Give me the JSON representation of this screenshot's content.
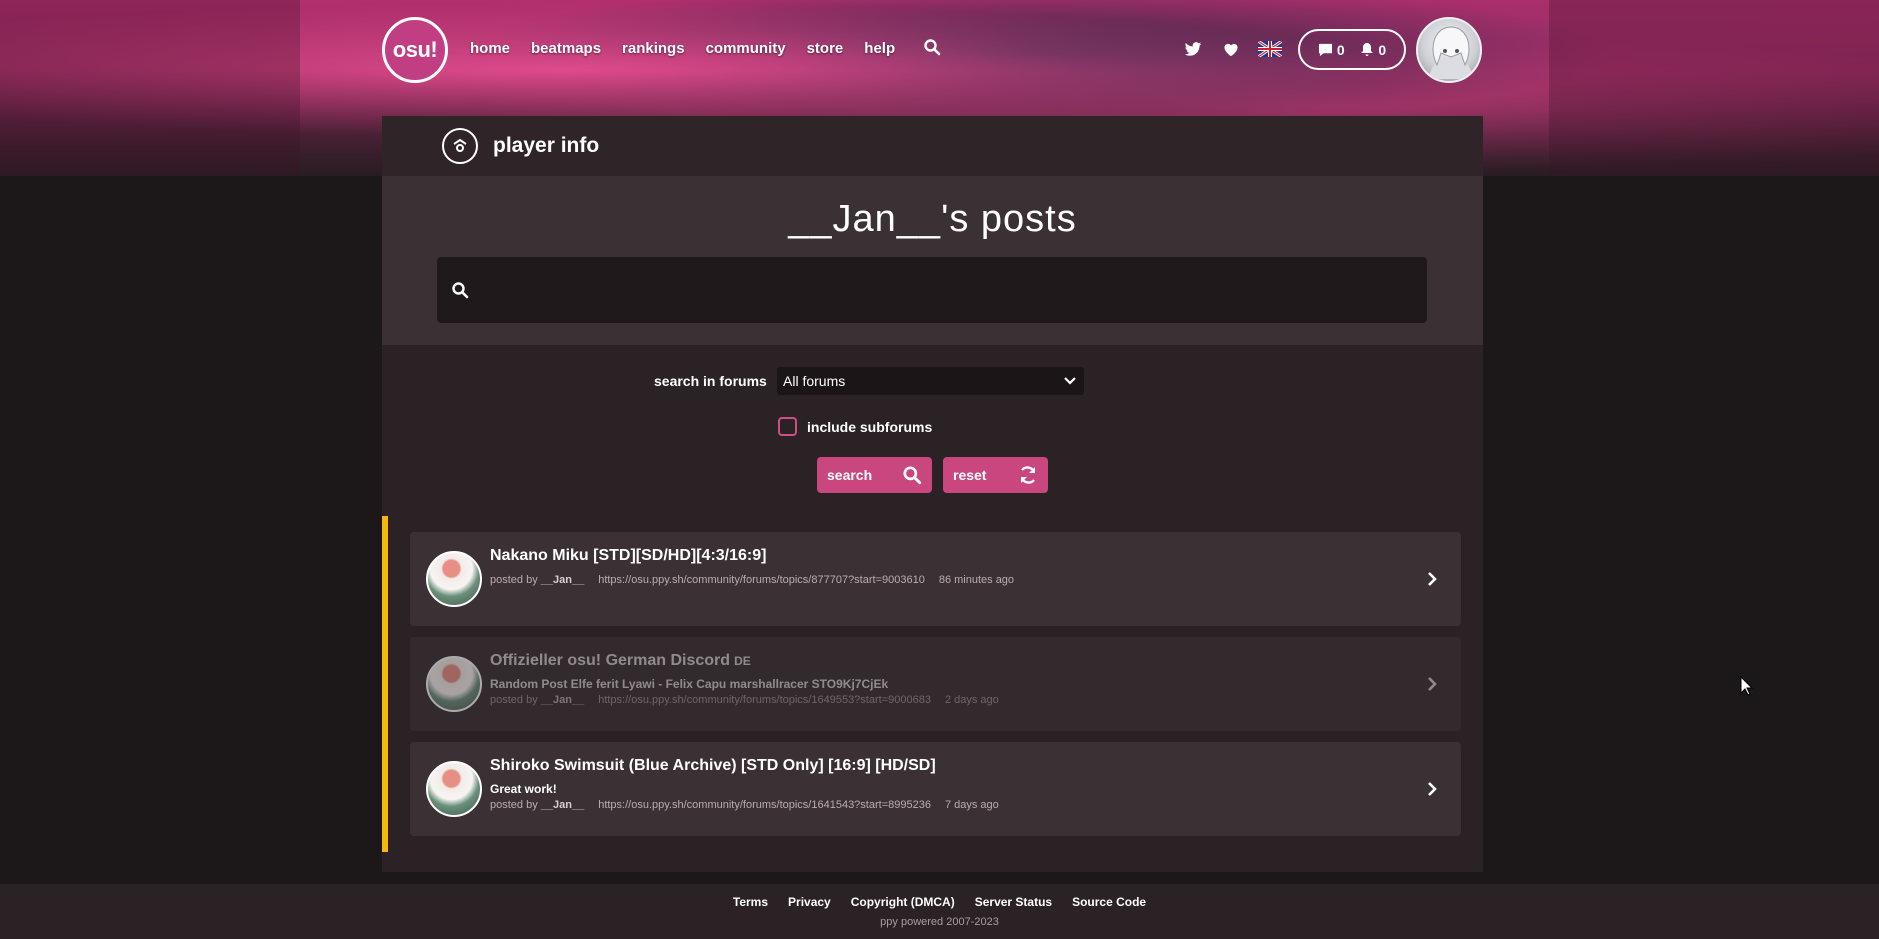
{
  "nav": {
    "logo_text": "osu!",
    "links": [
      "home",
      "beatmaps",
      "rankings",
      "community",
      "store",
      "help"
    ],
    "chat_count": "0",
    "notification_count": "0"
  },
  "header": {
    "section_title": "player info"
  },
  "page": {
    "title": "__Jan__'s posts",
    "search_value": ""
  },
  "filters": {
    "forum_label": "search in forums",
    "forum_selected": "All forums",
    "subforums_label": "include subforums",
    "subforums_checked": false,
    "search_button": "search",
    "reset_button": "reset"
  },
  "posts": [
    {
      "title": "Nakano Miku [STD][SD/HD][4:3/16:9]",
      "tag": "",
      "body": "",
      "posted_by_label": "posted by",
      "author": "__Jan__",
      "url": "https://osu.ppy.sh/community/forums/topics/877707?start=9003610",
      "time": "86 minutes ago",
      "dimmed": false
    },
    {
      "title": "Offizieller osu! German Discord",
      "tag": "DE",
      "body": "Random Post Elfe ferit Lyawi - Felix Capu marshallracer STO9Kj7CjEk",
      "posted_by_label": "posted by",
      "author": "__Jan__",
      "url": "https://osu.ppy.sh/community/forums/topics/1649553?start=9000683",
      "time": "2 days ago",
      "dimmed": true
    },
    {
      "title": "Shiroko Swimsuit (Blue Archive) [STD Only] [16:9] [HD/SD]",
      "tag": "",
      "body": "Great work!",
      "posted_by_label": "posted by",
      "author": "__Jan__",
      "url": "https://osu.ppy.sh/community/forums/topics/1641543?start=8995236",
      "time": "7 days ago",
      "dimmed": false
    }
  ],
  "footer": {
    "links": [
      "Terms",
      "Privacy",
      "Copyright (DMCA)",
      "Server Status",
      "Source Code"
    ],
    "copyright": "ppy powered 2007-2023"
  },
  "colors": {
    "accent": "#c9467f",
    "highlight_bar": "#f6b80e",
    "panel_bg": "#2b2226",
    "card_bg": "#3b3034",
    "page_bg": "#1c1719"
  },
  "icons": [
    "search-icon",
    "twitter-icon",
    "heart-icon",
    "uk-flag-icon",
    "chat-icon",
    "bell-icon",
    "player-info-icon",
    "chevron-down-icon",
    "refresh-icon",
    "chevron-right-icon"
  ]
}
